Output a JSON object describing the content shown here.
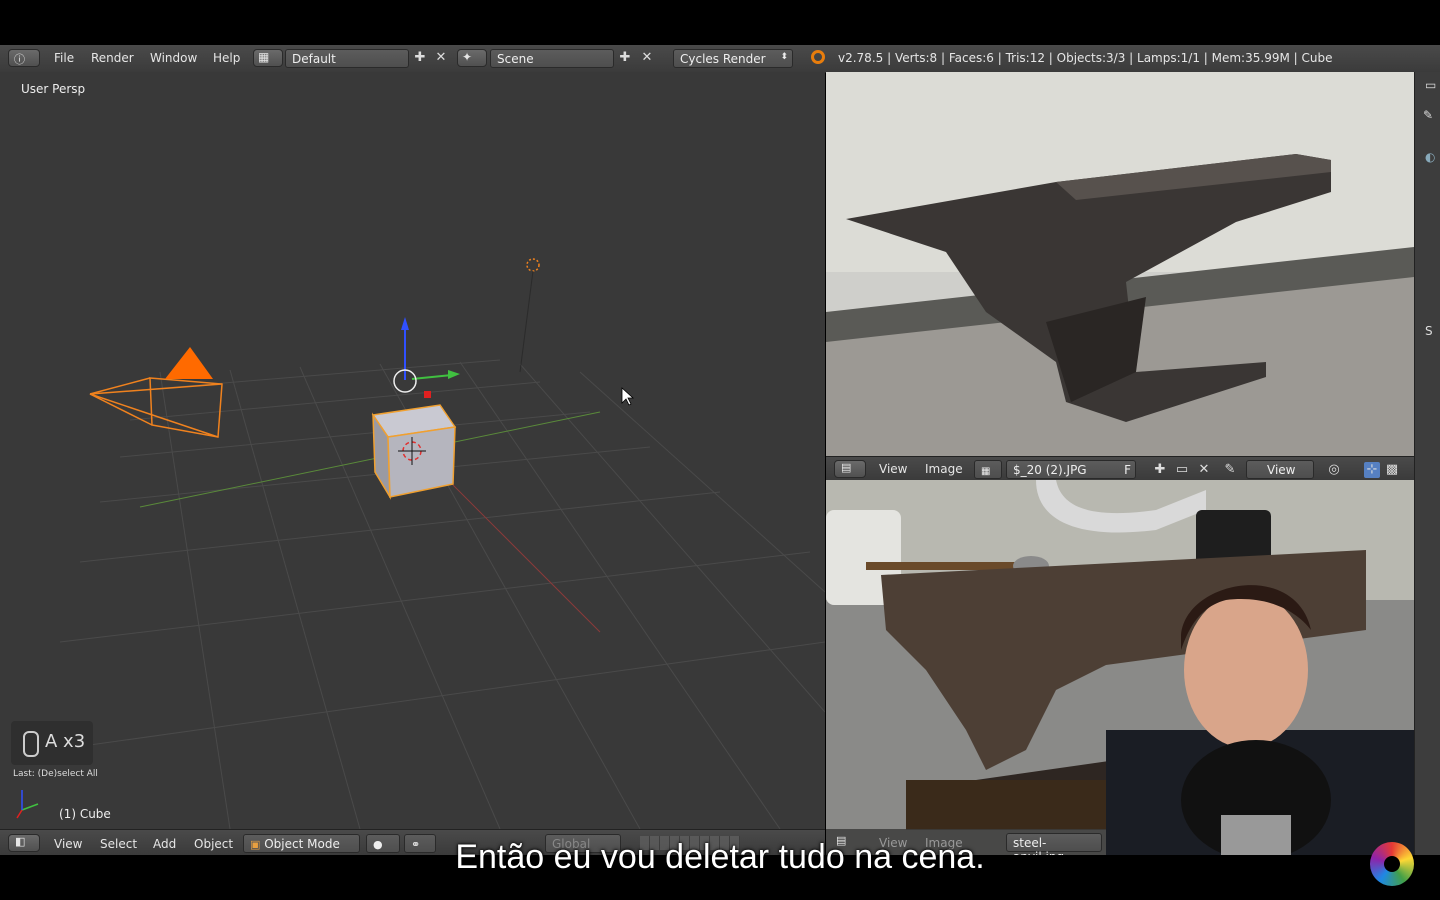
{
  "topbar": {
    "menu": [
      "File",
      "Render",
      "Window",
      "Help"
    ],
    "screen_layout": "Default",
    "scene": "Scene",
    "render_engine": "Cycles Render",
    "stats": "v2.78.5 | Verts:8 | Faces:6 | Tris:12 | Objects:3/3 | Lamps:1/1 | Mem:35.99M | Cube"
  },
  "viewport": {
    "view_label": "User Persp",
    "key_hint": "A x3",
    "last_operator": "Last: (De)select All",
    "active_object": "(1) Cube"
  },
  "viewport_header": {
    "menus": [
      "View",
      "Select",
      "Add",
      "Object"
    ],
    "mode": "Object Mode",
    "orientation": "Global"
  },
  "image_editor": {
    "menus": [
      "View",
      "Image"
    ],
    "image_name": "$_20 (2).JPG",
    "fake_user": "F",
    "view_mode": "View"
  },
  "cam_editor": {
    "menus": [
      "View",
      "Image"
    ],
    "image_name": "steel-anvil.jpg"
  },
  "subtitle": "Então eu vou deletar tudo na cena.",
  "colors": {
    "header": "#434343",
    "viewport_bg": "#393939",
    "selection": "#f0821e",
    "camera": "#ff6a00"
  }
}
